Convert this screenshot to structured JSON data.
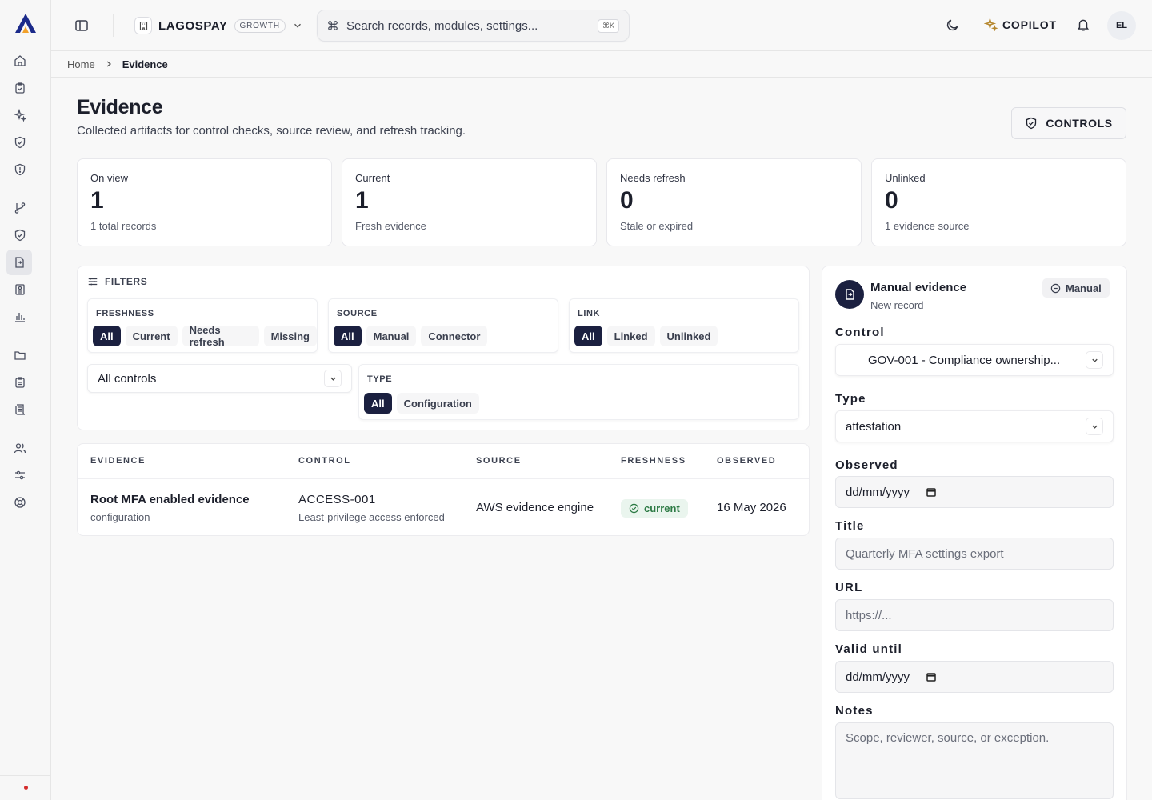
{
  "org": {
    "name": "LAGOSPAY",
    "plan": "GROWTH"
  },
  "search": {
    "placeholder": "Search records, modules, settings...",
    "shortcut": "⌘K"
  },
  "header": {
    "copilot_label": "COPILOT",
    "avatar_initials": "EL"
  },
  "breadcrumb": {
    "home": "Home",
    "current": "Evidence"
  },
  "page": {
    "title": "Evidence",
    "subtitle": "Collected artifacts for control checks, source review, and refresh tracking.",
    "controls_button": "CONTROLS"
  },
  "stats": [
    {
      "label": "On view",
      "value": "1",
      "sub": "1 total records"
    },
    {
      "label": "Current",
      "value": "1",
      "sub": "Fresh evidence"
    },
    {
      "label": "Needs refresh",
      "value": "0",
      "sub": "Stale or expired"
    },
    {
      "label": "Unlinked",
      "value": "0",
      "sub": "1 evidence source"
    }
  ],
  "filters": {
    "heading": "FILTERS",
    "freshness": {
      "label": "FRESHNESS",
      "options": [
        "All",
        "Current",
        "Needs refresh",
        "Missing"
      ],
      "selected": "All"
    },
    "source": {
      "label": "SOURCE",
      "options": [
        "All",
        "Manual",
        "Connector"
      ],
      "selected": "All"
    },
    "link": {
      "label": "LINK",
      "options": [
        "All",
        "Linked",
        "Unlinked"
      ],
      "selected": "All"
    },
    "control_select": "All controls",
    "type": {
      "label": "TYPE",
      "options": [
        "All",
        "Configuration"
      ],
      "selected": "All"
    }
  },
  "table": {
    "columns": [
      "EVIDENCE",
      "CONTROL",
      "SOURCE",
      "FRESHNESS",
      "OBSERVED"
    ],
    "rows": [
      {
        "evidence": "Root MFA enabled evidence",
        "evidence_type": "configuration",
        "control_id": "ACCESS-001",
        "control_name": "Least-privilege access enforced",
        "source": "AWS evidence engine",
        "freshness": "current",
        "observed": "16 May 2026"
      }
    ]
  },
  "panel": {
    "title": "Manual evidence",
    "subtitle": "New record",
    "tag": "Manual",
    "control_label": "Control",
    "control_value": "GOV-001 - Compliance ownership...",
    "type_label": "Type",
    "type_value": "attestation",
    "observed_label": "Observed",
    "observed_value": "dd/mm/yyyy",
    "title_label": "Title",
    "title_placeholder": "Quarterly MFA settings export",
    "url_label": "URL",
    "url_placeholder": "https://...",
    "valid_label": "Valid until",
    "valid_value": "dd/mm/yyyy",
    "notes_label": "Notes",
    "notes_placeholder": "Scope, reviewer, source, or exception."
  },
  "colors": {
    "accent": "#1b2040",
    "success_bg": "#eaf5ee",
    "success_fg": "#2c7a44",
    "copilot": "#b5862c",
    "status_dot": "#d42d2d"
  }
}
